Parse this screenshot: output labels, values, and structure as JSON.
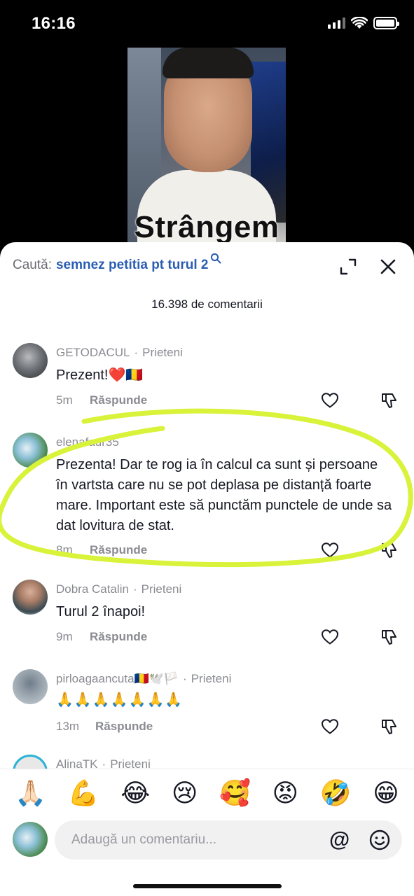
{
  "status_bar": {
    "time": "16:16"
  },
  "video": {
    "caption": "Strângem"
  },
  "header": {
    "search_prefix": "Caută:",
    "search_query": "semnez petitia pt turul 2",
    "comment_count": "16.398 de comentarii"
  },
  "comments": [
    {
      "username": "GETODACUL",
      "badge": "Prieteni",
      "text": "Prezent!❤️🇷🇴",
      "time": "5m",
      "reply_label": "Răspunde"
    },
    {
      "username": "elenafaur35",
      "badge": "",
      "text": "Prezenta! Dar te rog ia în calcul ca sunt și persoane în vartsta care nu se pot deplasa pe distanță foarte mare. Important este să punctăm punctele de unde sa dat lovitura de stat.",
      "time": "8m",
      "reply_label": "Răspunde"
    },
    {
      "username": "Dobra Catalin",
      "badge": "Prieteni",
      "text": "Turul 2 înapoi!",
      "time": "9m",
      "reply_label": "Răspunde"
    },
    {
      "username": "pirloagaancuta🇷🇴🕊️🏳️",
      "badge": "Prieteni",
      "text": "🙏🙏🙏🙏🙏🙏🙏",
      "time": "13m",
      "reply_label": "Răspunde"
    },
    {
      "username": "AlinaTK",
      "badge": "Prieteni",
      "text": "",
      "time": "",
      "reply_label": ""
    }
  ],
  "emoji_bar": [
    "🙏🏻",
    "💪",
    "😂",
    "😢",
    "🥰",
    "😡",
    "🤣",
    "😁"
  ],
  "composer": {
    "placeholder": "Adaugă un comentariu...",
    "at_symbol": "@"
  },
  "colors": {
    "accent_link": "#2b5db3",
    "highlight_marker": "#d9f23a",
    "secondary_text": "#8a8b91"
  }
}
